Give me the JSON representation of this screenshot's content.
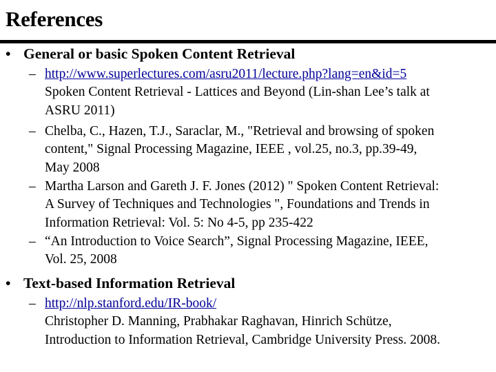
{
  "slide": {
    "title": "References",
    "sections": [
      {
        "bullet": "•",
        "heading": "General or basic Spoken Content Retrieval",
        "items": [
          {
            "dash": "–",
            "link": "http://www.superlectures.com/asru2011/lecture.php?lang=en&id=5",
            "lines": [
              "Spoken Content Retrieval - Lattices and Beyond (Lin-shan Lee’s talk at",
              "ASRU 2011)"
            ]
          },
          {
            "dash": "–",
            "lines": [
              "Chelba, C., Hazen, T.J., Saraclar, M., \"Retrieval and browsing of spoken",
              "content,\" Signal Processing Magazine, IEEE , vol.25, no.3, pp.39-49,",
              "May 2008"
            ]
          },
          {
            "dash": "–",
            "lines": [
              "Martha Larson and Gareth J. F. Jones (2012) \" Spoken Content Retrieval:",
              "A Survey of Techniques and Technologies \", Foundations and Trends in",
              "Information Retrieval: Vol. 5: No 4-5, pp 235-422"
            ]
          },
          {
            "dash": "–",
            "lines": [
              "“An Introduction to Voice Search”, Signal Processing Magazine, IEEE,",
              "Vol. 25, 2008"
            ]
          }
        ]
      },
      {
        "bullet": "•",
        "heading": "Text-based Information Retrieval",
        "items": [
          {
            "dash": "–",
            "link": "http://nlp.stanford.edu/IR-book/",
            "lines": [
              "Christopher D. Manning, Prabhakar Raghavan, Hinrich Schütze,",
              "Introduction to Information Retrieval, Cambridge University Press. 2008."
            ]
          }
        ]
      }
    ],
    "colors": {
      "link": "#000099",
      "text": "#000000",
      "background": "#ffffff"
    }
  }
}
